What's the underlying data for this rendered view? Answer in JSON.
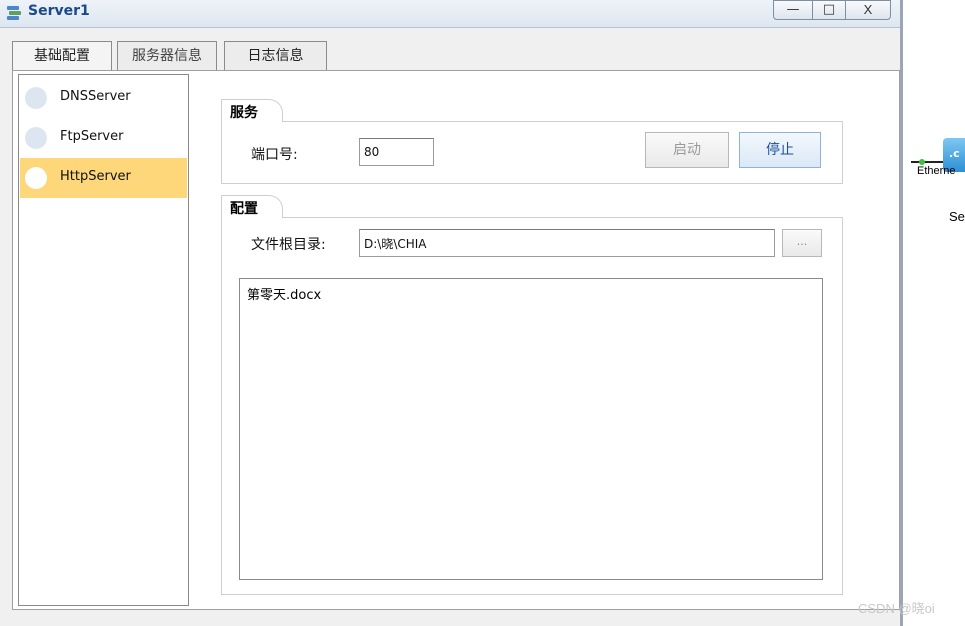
{
  "window": {
    "title": "Server1",
    "minimize_label": "—",
    "maximize_label": "□",
    "close_label": "X"
  },
  "tabs": [
    {
      "label": "基础配置"
    },
    {
      "label": "服务器信息"
    },
    {
      "label": "日志信息"
    }
  ],
  "sidebar": {
    "items": [
      {
        "label": "DNSServer",
        "selected": false
      },
      {
        "label": "FtpServer",
        "selected": false
      },
      {
        "label": "HttpServer",
        "selected": true
      }
    ]
  },
  "service_group": {
    "title": "服务",
    "port_label": "端口号:",
    "port_value": "80",
    "start_label": "启动",
    "stop_label": "停止"
  },
  "config_group": {
    "title": "配置",
    "root_dir_label": "文件根目录:",
    "root_dir_value": "D:\\晓\\CHIA",
    "browse_label": "...",
    "files": [
      "第零天.docx"
    ]
  },
  "canvas": {
    "node_icon_text": ".c",
    "link_label": "Etherne",
    "node_label": "Se"
  },
  "watermark": "CSDN @晓oi",
  "colors": {
    "selected_item": "#fdd77a",
    "title_text": "#1a4a8a",
    "stop_button_text": "#1c4fa0"
  }
}
